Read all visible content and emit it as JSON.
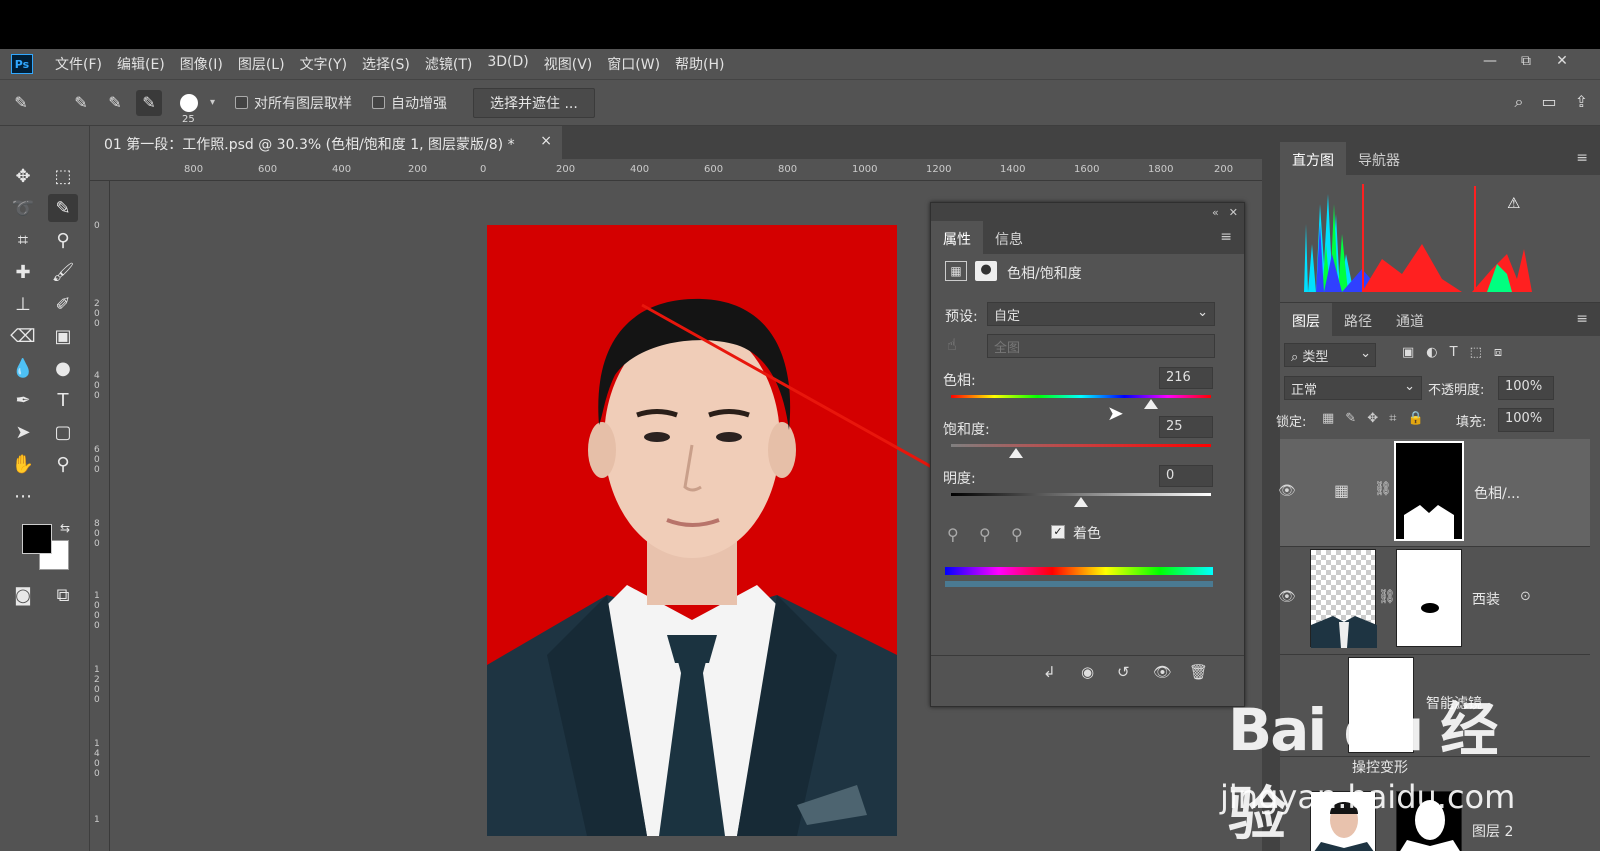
{
  "app": {
    "logo": "Ps"
  },
  "menu": [
    "文件(F)",
    "编辑(E)",
    "图像(I)",
    "图层(L)",
    "文字(Y)",
    "选择(S)",
    "滤镜(T)",
    "3D(D)",
    "视图(V)",
    "窗口(W)",
    "帮助(H)"
  ],
  "window_controls": {
    "minimize": "—",
    "restore": "⧉",
    "close": "✕"
  },
  "options": {
    "brush_size": "25",
    "sample_all_label": "对所有图层取样",
    "auto_enhance_label": "自动增强",
    "select_mask_button": "选择并遮住 ..."
  },
  "document": {
    "tab_title": "01 第一段：工作照.psd @ 30.3% (色相/饱和度 1, 图层蒙版/8) *",
    "close": "×"
  },
  "ruler_top": [
    "800",
    "600",
    "400",
    "200",
    "0",
    "200",
    "400",
    "600",
    "800",
    "1000",
    "1200",
    "1400",
    "1600",
    "1800",
    "200"
  ],
  "ruler_left": [
    "0",
    "200",
    "400",
    "600",
    "800",
    "1000",
    "1200",
    "1400",
    "1"
  ],
  "properties": {
    "tab_properties": "属性",
    "tab_info": "信息",
    "adjustment_title": "色相/饱和度",
    "preset_label": "预设:",
    "preset_value": "自定",
    "channel_value": "全图",
    "hue_label": "色相:",
    "hue_value": "216",
    "saturation_label": "饱和度:",
    "saturation_value": "25",
    "lightness_label": "明度:",
    "lightness_value": "0",
    "colorize_label": "着色",
    "colorize_checked": true,
    "slider_positions": {
      "hue": 0.77,
      "saturation": 0.25,
      "lightness": 0.5
    }
  },
  "histogram": {
    "tab_histogram": "直方图",
    "tab_navigator": "导航器",
    "warning": "⚠"
  },
  "layers": {
    "tab_layers": "图层",
    "tab_paths": "路径",
    "tab_channels": "通道",
    "filter_label": "类型",
    "blend_mode": "正常",
    "opacity_label": "不透明度:",
    "opacity_value": "100%",
    "lock_label": "锁定:",
    "fill_label": "填充:",
    "fill_value": "100%",
    "items": [
      {
        "name": "色相/..."
      },
      {
        "name": "西装"
      },
      {
        "name": "智能滤镜"
      },
      {
        "name": "操控变形"
      },
      {
        "name": "图层 2"
      }
    ]
  },
  "watermark": {
    "logo": "Bai du 经验",
    "url": "jingyan.baidu.com"
  },
  "colors": {
    "photo_bg": "#d40000",
    "panel": "#535353",
    "arrow": "#e8160c"
  }
}
